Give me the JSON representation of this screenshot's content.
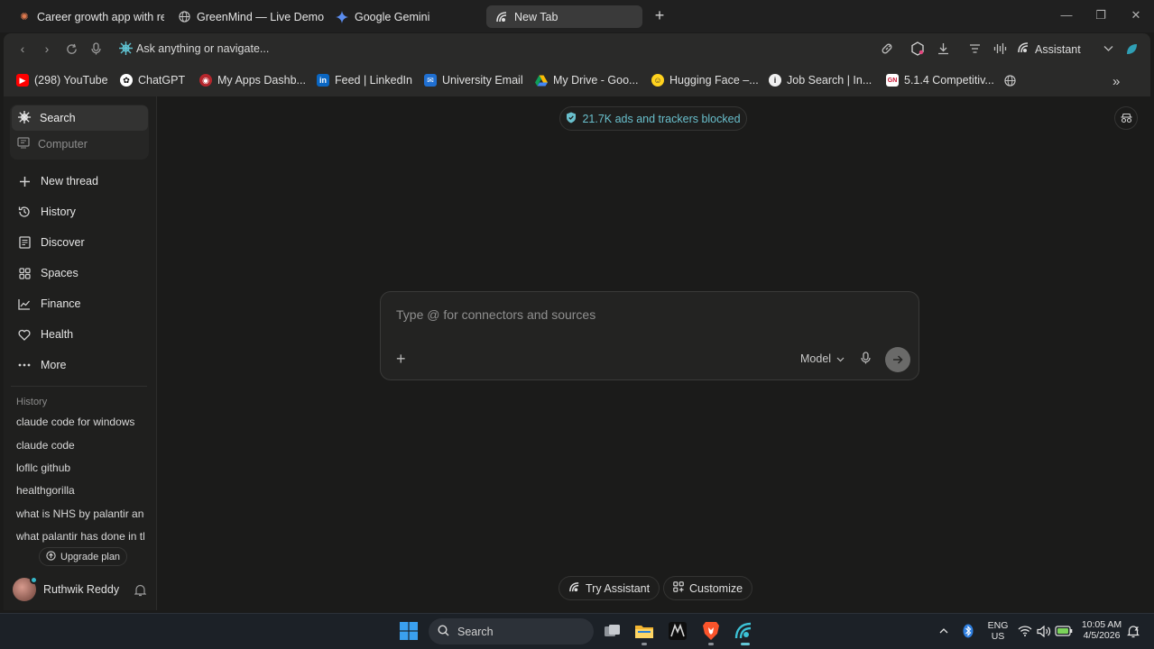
{
  "tabs": [
    {
      "label": "Career growth app with re",
      "active": false
    },
    {
      "label": "GreenMind — Live Demo",
      "active": false
    },
    {
      "label": "Google Gemini",
      "active": false
    },
    {
      "label": "New Tab",
      "active": true
    }
  ],
  "toolbar": {
    "omnibox_placeholder": "Ask anything or navigate...",
    "assistant_label": "Assistant"
  },
  "bookmarks": [
    {
      "label": "(298) YouTube",
      "icon": "youtube-icon"
    },
    {
      "label": "ChatGPT",
      "icon": "chatgpt-icon"
    },
    {
      "label": "My Apps Dashb...",
      "icon": "apps-icon"
    },
    {
      "label": "Feed | LinkedIn",
      "icon": "linkedin-icon"
    },
    {
      "label": "University Email",
      "icon": "email-icon"
    },
    {
      "label": "My Drive - Goo...",
      "icon": "drive-icon"
    },
    {
      "label": "Hugging Face –...",
      "icon": "huggingface-icon"
    },
    {
      "label": "Job Search | In...",
      "icon": "info-icon"
    },
    {
      "label": "5.1.4 Competitiv...",
      "icon": "doc-icon"
    }
  ],
  "sidebar": {
    "modes": [
      {
        "label": "Search",
        "active": true
      },
      {
        "label": "Computer",
        "active": false
      }
    ],
    "nav": [
      {
        "label": "New thread",
        "icon": "plus-icon"
      },
      {
        "label": "History",
        "icon": "history-icon"
      },
      {
        "label": "Discover",
        "icon": "discover-icon"
      },
      {
        "label": "Spaces",
        "icon": "spaces-icon"
      },
      {
        "label": "Finance",
        "icon": "finance-icon"
      },
      {
        "label": "Health",
        "icon": "heart-icon"
      },
      {
        "label": "More",
        "icon": "more-icon"
      }
    ],
    "history_label": "History",
    "history": [
      "claude code for windows",
      "claude code",
      "lofllc github",
      "healthgorilla",
      "what is NHS by palantir and",
      "what palantir has done in th"
    ],
    "upgrade_label": "Upgrade plan",
    "user_name": "Ruthwik Reddy"
  },
  "main": {
    "tracker_text": "21.7K ads and trackers blocked",
    "composer_placeholder": "Type @ for connectors and sources",
    "model_label": "Model",
    "try_assistant_label": "Try Assistant",
    "customize_label": "Customize"
  },
  "taskbar": {
    "search_label": "Search",
    "lang_top": "ENG",
    "lang_bottom": "US",
    "time": "10:05 AM",
    "date": "4/5/2026"
  },
  "colors": {
    "accent": "#69bfcc",
    "background": "#1b1b1a",
    "sidebar": "#1f1f1e"
  }
}
